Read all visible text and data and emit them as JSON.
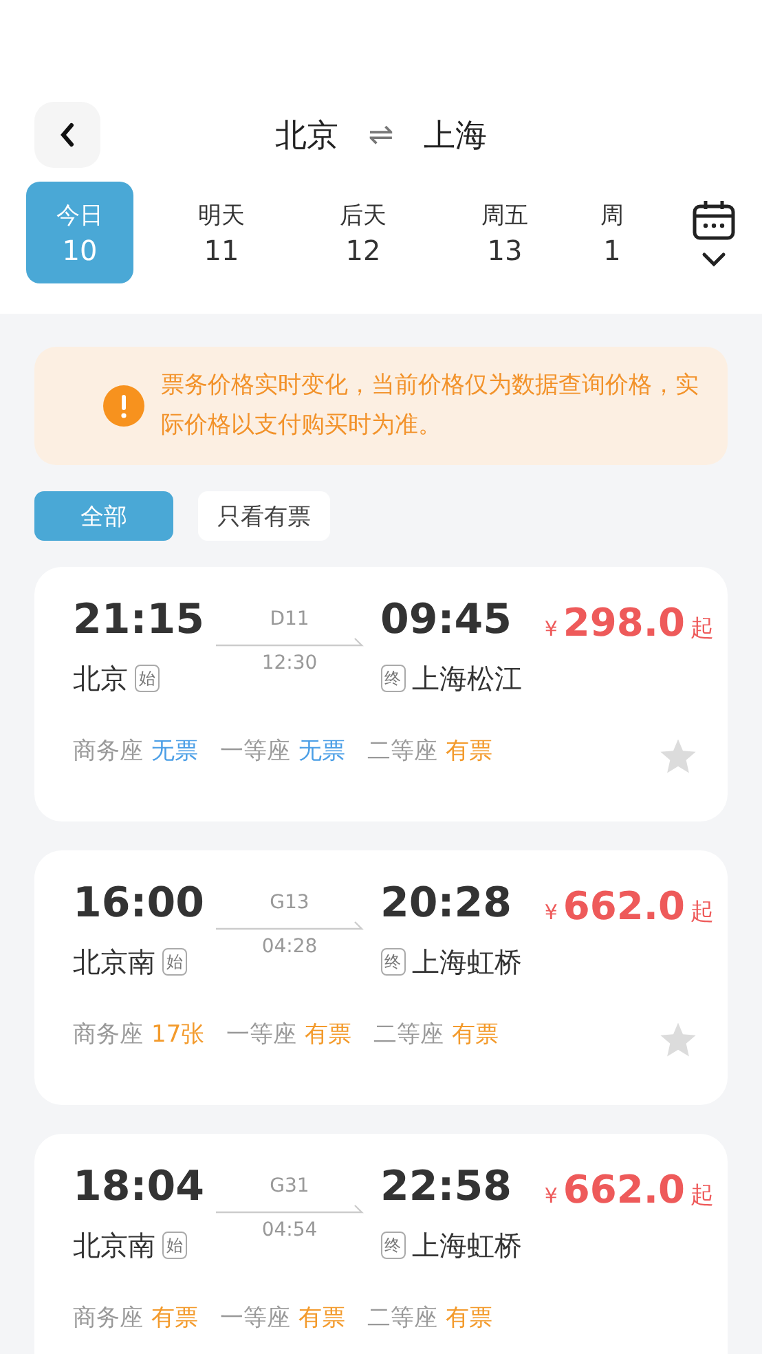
{
  "header": {
    "from": "北京",
    "swap": "⇌",
    "to": "上海"
  },
  "dates": [
    {
      "label": "今日",
      "day": "10",
      "selected": true
    },
    {
      "label": "明天",
      "day": "11",
      "selected": false
    },
    {
      "label": "后天",
      "day": "12",
      "selected": false
    },
    {
      "label": "周五",
      "day": "13",
      "selected": false
    },
    {
      "label": "周",
      "day": "1",
      "selected": false
    }
  ],
  "notice": "票务价格实时变化，当前价格仅为数据查询价格，实际价格以支付购买时为准。",
  "filters": [
    {
      "label": "全部",
      "selected": true
    },
    {
      "label": "只看有票",
      "selected": false
    }
  ],
  "trains": [
    {
      "depart": "21:15",
      "number": "D11",
      "arrive": "09:45",
      "currency": "¥",
      "price": "298.0",
      "price_suffix": "起",
      "from": "北京",
      "from_tag": "始",
      "duration": "12:30",
      "to_tag": "终",
      "to": "上海松江",
      "favorite": false,
      "seats": [
        {
          "name": "商务座",
          "status": "无票",
          "available": false
        },
        {
          "name": "一等座",
          "status": "无票",
          "available": false
        },
        {
          "name": "二等座",
          "status": "有票",
          "available": true
        }
      ]
    },
    {
      "depart": "16:00",
      "number": "G13",
      "arrive": "20:28",
      "currency": "¥",
      "price": "662.0",
      "price_suffix": "起",
      "from": "北京南",
      "from_tag": "始",
      "duration": "04:28",
      "to_tag": "终",
      "to": "上海虹桥",
      "favorite": false,
      "seats": [
        {
          "name": "商务座",
          "status": "17张",
          "available": true
        },
        {
          "name": "一等座",
          "status": "有票",
          "available": true
        },
        {
          "name": "二等座",
          "status": "有票",
          "available": true
        }
      ]
    },
    {
      "depart": "18:04",
      "number": "G31",
      "arrive": "22:58",
      "currency": "¥",
      "price": "662.0",
      "price_suffix": "起",
      "from": "北京南",
      "from_tag": "始",
      "duration": "04:54",
      "to_tag": "终",
      "to": "上海虹桥",
      "seats": [
        {
          "name": "商务座",
          "status": "有票",
          "available": true
        },
        {
          "name": "一等座",
          "status": "有票",
          "available": true
        },
        {
          "name": "二等座",
          "status": "有票",
          "available": true
        }
      ]
    }
  ]
}
